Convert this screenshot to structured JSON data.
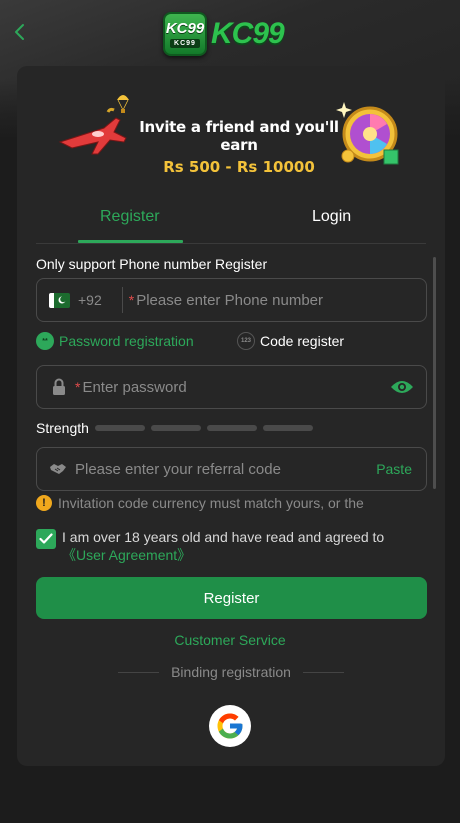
{
  "header": {
    "back_icon": "chevron-left-icon",
    "logo_badge_text": "KC99",
    "logo_badge_sub": "KC99",
    "logo_text": "KC99"
  },
  "banner": {
    "line1": "Invite a friend and you'll earn",
    "line2": "Rs 500 - Rs 10000"
  },
  "tabs": [
    {
      "label": "Register",
      "active": true
    },
    {
      "label": "Login",
      "active": false
    }
  ],
  "form": {
    "section_title": "Only support Phone number Register",
    "phone": {
      "country_code": "+92",
      "required_mark": "*",
      "placeholder": "Please enter Phone number",
      "value": ""
    },
    "modes": [
      {
        "label": "Password registration",
        "icon_text": "**",
        "active": true
      },
      {
        "label": "Code register",
        "icon_text": "123",
        "active": false
      }
    ],
    "password": {
      "required_mark": "*",
      "placeholder": "Enter password",
      "value": ""
    },
    "strength": {
      "label": "Strength",
      "level": 0,
      "segments": 4
    },
    "referral": {
      "placeholder": "Please enter your referral code",
      "paste_label": "Paste",
      "value": ""
    },
    "notice": "Invitation code currency must match yours, or the",
    "agreement": {
      "checked": true,
      "text": "I am over 18 years old and have read and agreed to ",
      "link": "《User Agreement》"
    },
    "register_button": "Register",
    "customer_service": "Customer Service",
    "binding_label": "Binding registration",
    "google_icon": "google-icon"
  },
  "colors": {
    "accent": "#2da85a",
    "button": "#1f8f48",
    "background": "#1c1c1c",
    "card": "#262626",
    "gold": "#f3c23a",
    "warning": "#f0a81d"
  }
}
